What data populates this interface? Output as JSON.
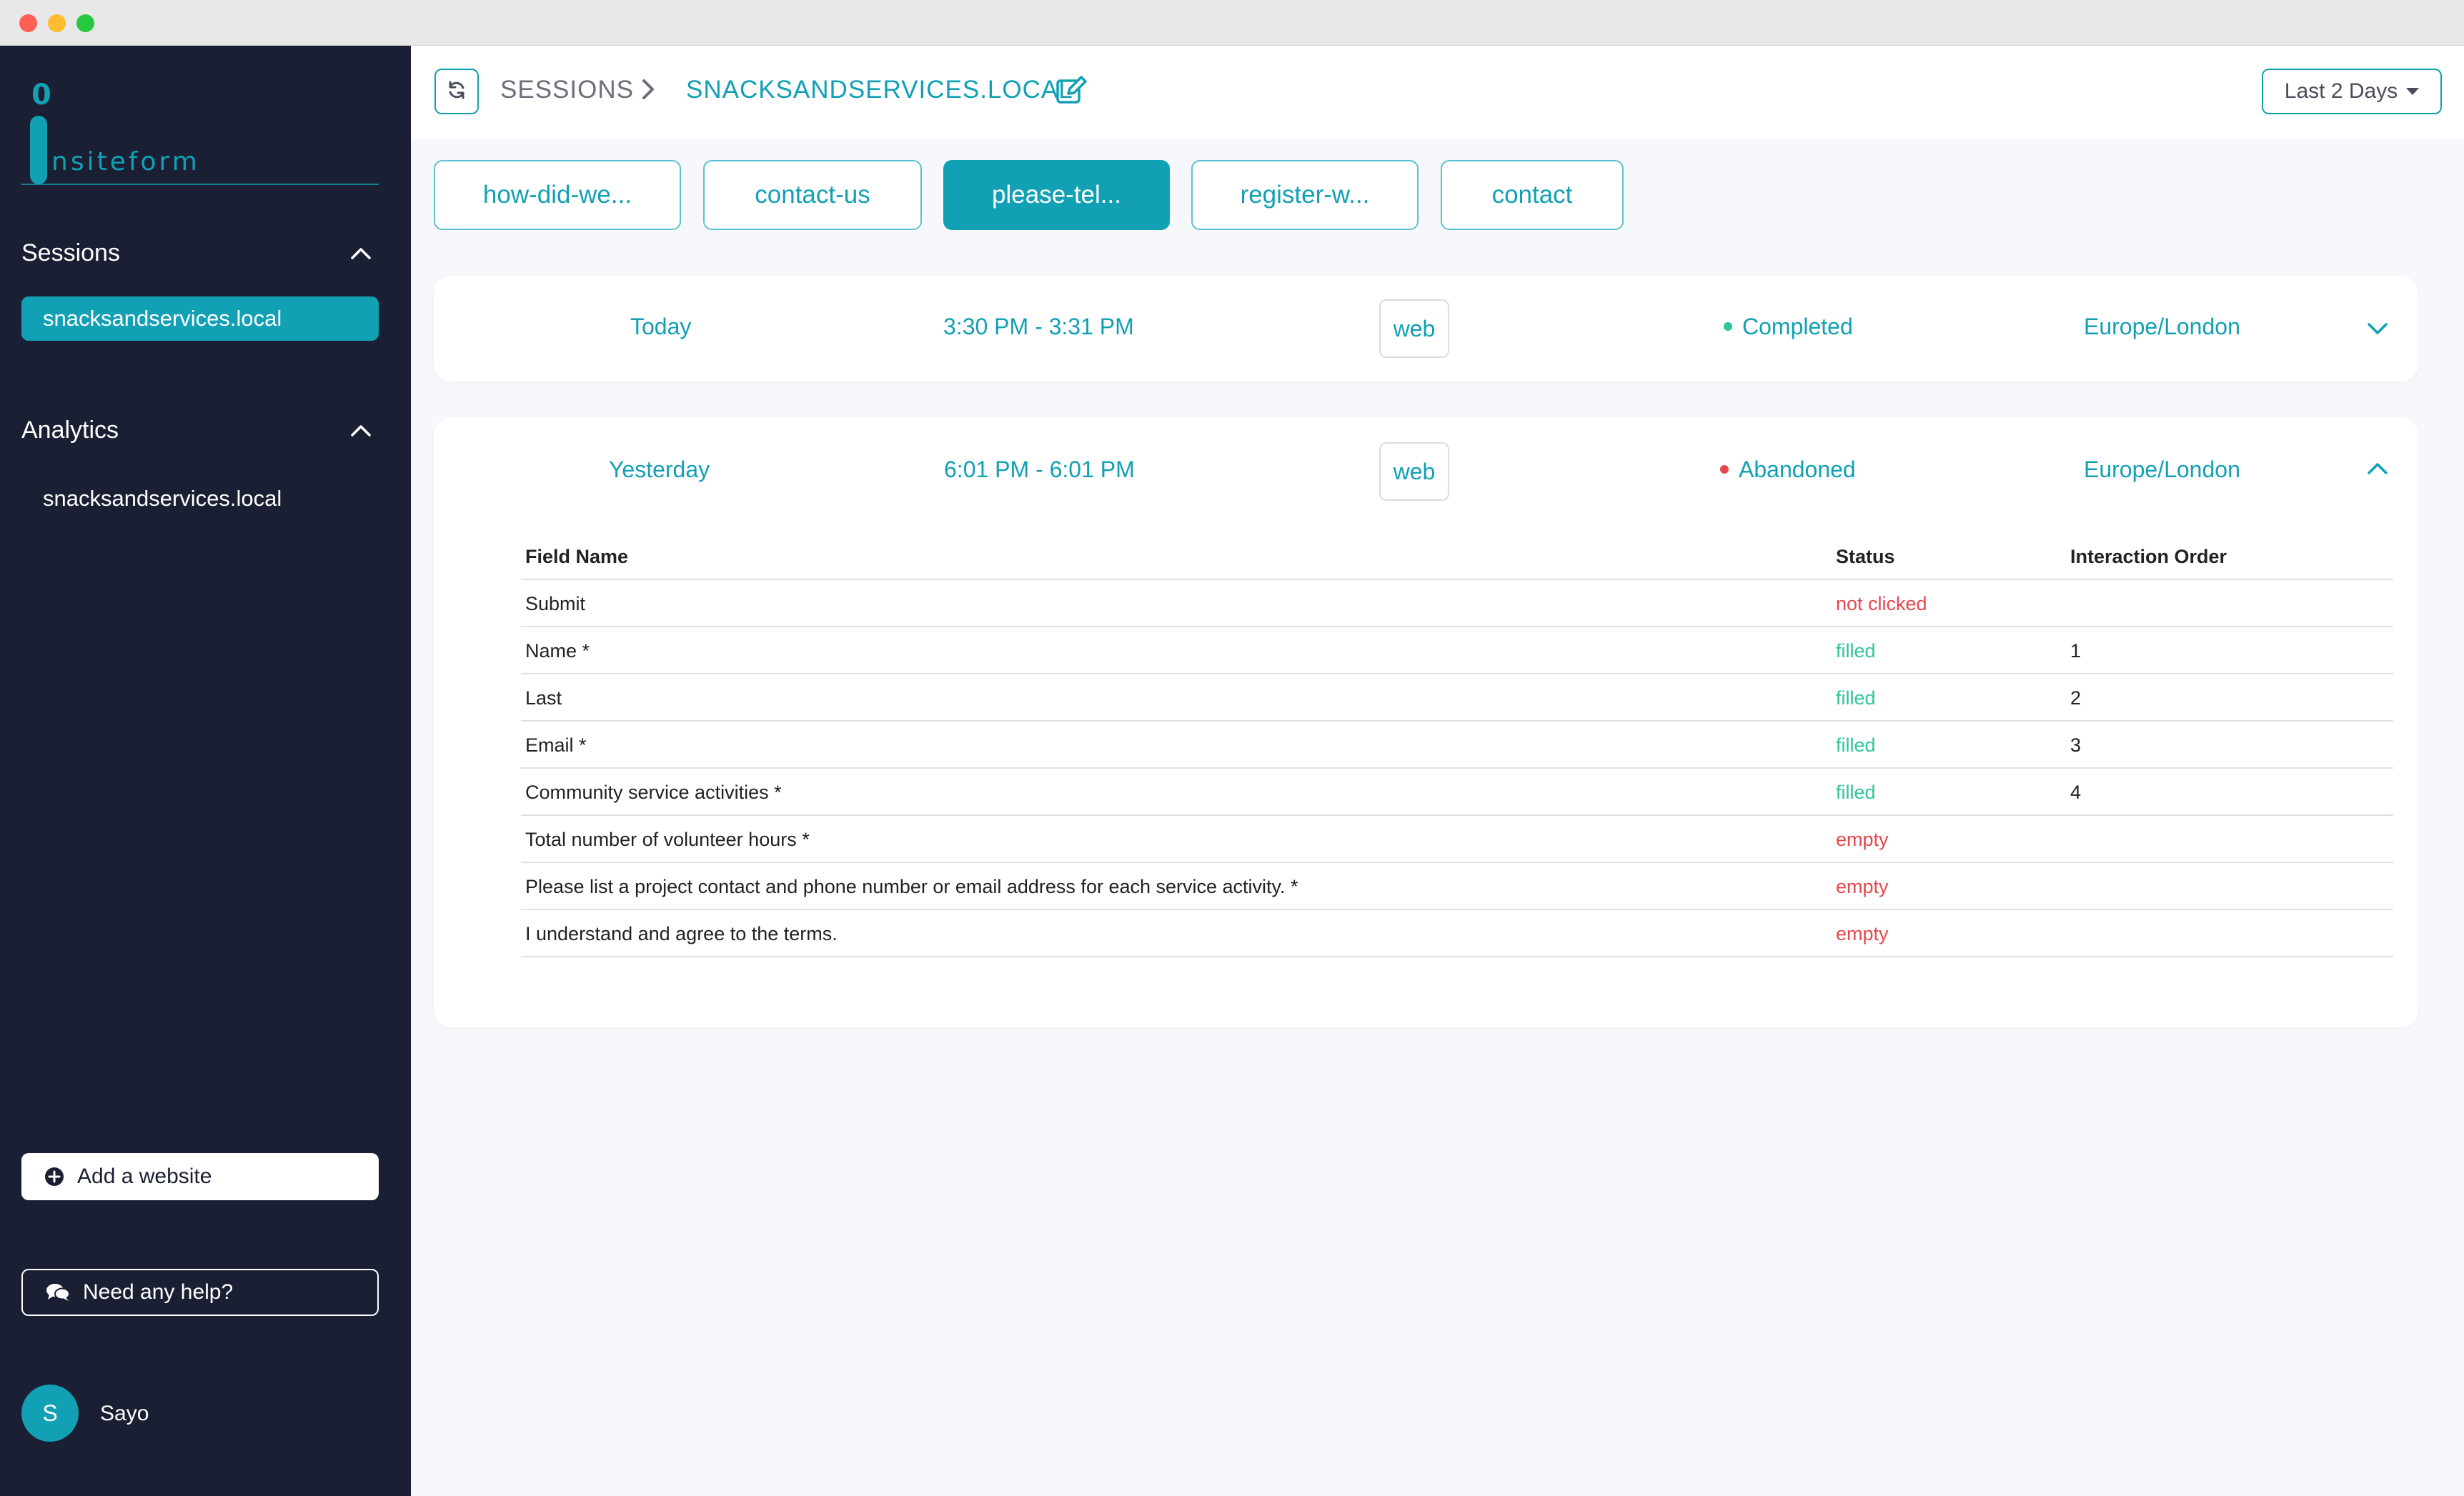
{
  "app": {
    "logo_mark": "0",
    "logo_text": "nsiteform"
  },
  "sidebar": {
    "sessions_heading": "Sessions",
    "sessions_items": [
      {
        "label": "snacksandservices.local",
        "active": true
      }
    ],
    "analytics_heading": "Analytics",
    "analytics_items": [
      {
        "label": "snacksandservices.local",
        "active": false
      }
    ],
    "add_website_label": "Add a website",
    "help_label": "Need any help?",
    "user": {
      "initial": "S",
      "name": "Sayo"
    }
  },
  "header": {
    "breadcrumb": {
      "root": "SESSIONS",
      "current": "SNACKSANDSERVICES.LOCAL"
    },
    "date_range": "Last 2 Days"
  },
  "form_tabs": [
    {
      "label": "how-did-we...",
      "active": false
    },
    {
      "label": "contact-us",
      "active": false
    },
    {
      "label": "please-tel...",
      "active": true
    },
    {
      "label": "register-w...",
      "active": false
    },
    {
      "label": "contact",
      "active": false
    }
  ],
  "sessions": [
    {
      "day": "Today",
      "time": "3:30 PM - 3:31 PM",
      "platform": "web",
      "status": "Completed",
      "timezone": "Europe/London",
      "expanded": false
    },
    {
      "day": "Yesterday",
      "time": "6:01 PM - 6:01 PM",
      "platform": "web",
      "status": "Abandoned",
      "timezone": "Europe/London",
      "expanded": true
    }
  ],
  "fields_table": {
    "columns": [
      "Field Name",
      "Status",
      "Interaction Order"
    ],
    "rows": [
      {
        "field": "Submit",
        "status": "not clicked",
        "order": ""
      },
      {
        "field": "Name *",
        "status": "filled",
        "order": "1"
      },
      {
        "field": "Last",
        "status": "filled",
        "order": "2"
      },
      {
        "field": "Email *",
        "status": "filled",
        "order": "3"
      },
      {
        "field": "Community service activities *",
        "status": "filled",
        "order": "4"
      },
      {
        "field": "Total number of volunteer hours *",
        "status": "empty",
        "order": ""
      },
      {
        "field": "Please list a project contact and phone number or email address for each service activity. *",
        "status": "empty",
        "order": ""
      },
      {
        "field": "I understand and agree to the terms.",
        "status": "empty",
        "order": ""
      }
    ]
  },
  "colors": {
    "accent": "#11a0b4",
    "sidebar_bg": "#1b1f33",
    "completed": "#2ec4a0",
    "abandoned": "#e5484d",
    "filled": "#2ec4a0",
    "empty": "#e5484d"
  },
  "icons": [
    "refresh-icon",
    "chevron-right-icon",
    "edit-icon",
    "chevron-up-icon",
    "chevron-down-icon",
    "plus-circle-icon",
    "comments-icon"
  ]
}
